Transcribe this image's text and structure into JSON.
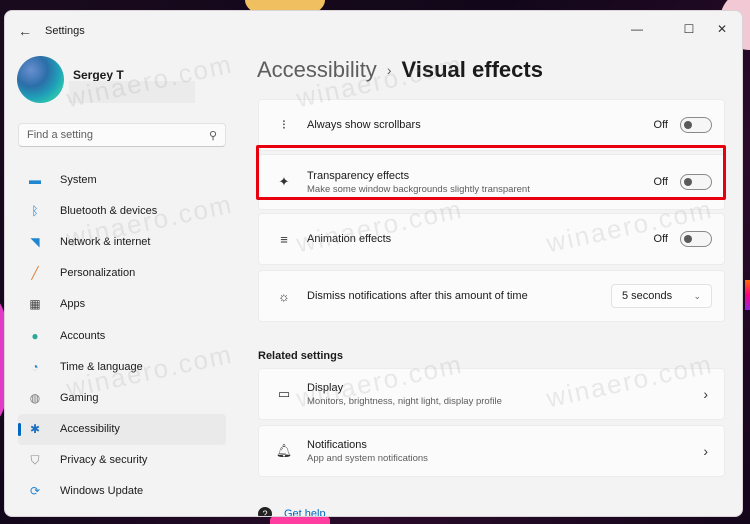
{
  "window": {
    "title": "Settings",
    "controls": {
      "minimize": "—",
      "maximize": "☐",
      "close": "✕"
    }
  },
  "profile": {
    "name": "Sergey T"
  },
  "search": {
    "placeholder": "Find a setting"
  },
  "sidebar": {
    "items": [
      {
        "label": "System",
        "icon": "system-icon",
        "glyph": "▬",
        "color": "#1f86d0",
        "active": false
      },
      {
        "label": "Bluetooth & devices",
        "icon": "bluetooth-icon",
        "glyph": "ᛒ",
        "color": "#1f86d0",
        "active": false
      },
      {
        "label": "Network & internet",
        "icon": "wifi-icon",
        "glyph": "◥",
        "color": "#1f86d0",
        "active": false
      },
      {
        "label": "Personalization",
        "icon": "brush-icon",
        "glyph": "╱",
        "color": "#e07a30",
        "active": false
      },
      {
        "label": "Apps",
        "icon": "apps-icon",
        "glyph": "▦",
        "color": "#444444",
        "active": false
      },
      {
        "label": "Accounts",
        "icon": "accounts-icon",
        "glyph": "●",
        "color": "#2aa89a",
        "active": false
      },
      {
        "label": "Time & language",
        "icon": "clock-globe-icon",
        "glyph": "◔",
        "color": "#1f86d0",
        "active": false
      },
      {
        "label": "Gaming",
        "icon": "gamepad-icon",
        "glyph": "◍",
        "color": "#777777",
        "active": false
      },
      {
        "label": "Accessibility",
        "icon": "accessibility-icon",
        "glyph": "✱",
        "color": "#1f6fc0",
        "active": true
      },
      {
        "label": "Privacy & security",
        "icon": "shield-icon",
        "glyph": "⛉",
        "color": "#888888",
        "active": false
      },
      {
        "label": "Windows Update",
        "icon": "update-icon",
        "glyph": "⟳",
        "color": "#1f86d0",
        "active": false
      }
    ]
  },
  "breadcrumb": {
    "parent": "Accessibility",
    "separator": "›",
    "current": "Visual effects"
  },
  "settings": [
    {
      "title": "Always show scrollbars",
      "subtitle": "",
      "icon": "scrollbar-icon",
      "glyph": "⁝",
      "state": "Off",
      "on": false
    },
    {
      "title": "Transparency effects",
      "subtitle": "Make some window backgrounds slightly transparent",
      "icon": "transparency-icon",
      "glyph": "✦",
      "state": "Off",
      "on": false,
      "highlighted": true
    },
    {
      "title": "Animation effects",
      "subtitle": "",
      "icon": "animation-icon",
      "glyph": "≡",
      "state": "Off",
      "on": false
    }
  ],
  "dismiss": {
    "title": "Dismiss notifications after this amount of time",
    "icon": "notification-timer-icon",
    "glyph": "☼",
    "value": "5 seconds",
    "chevron": "⌄"
  },
  "related": {
    "heading": "Related settings",
    "items": [
      {
        "title": "Display",
        "subtitle": "Monitors, brightness, night light, display profile",
        "icon": "laptop-icon",
        "glyph": "▭"
      },
      {
        "title": "Notifications",
        "subtitle": "App and system notifications",
        "icon": "bell-icon",
        "glyph": "🔔︎"
      }
    ],
    "chevron": "›"
  },
  "help": {
    "label": "Get help"
  },
  "watermark": "winaero.com",
  "colors": {
    "accent": "#0067c0",
    "highlight": "#e8000e"
  }
}
